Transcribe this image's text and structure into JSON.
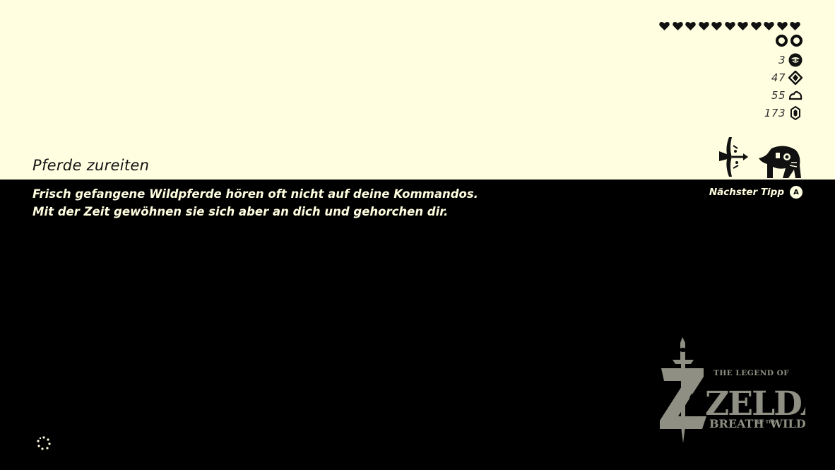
{
  "hint": {
    "title": "Pferde zureiten",
    "lines": [
      "Frisch gefangene Wildpferde hören oft nicht auf deine Kommandos.",
      "Mit der Zeit gewöhnen sie sich aber an dich und gehorchen dir."
    ],
    "next_label": "Nächster Tipp",
    "next_button": "A"
  },
  "hud": {
    "hearts": 11,
    "stamina_wheels": 2,
    "resources": [
      {
        "value": "3",
        "icon": "korok-seed-icon"
      },
      {
        "value": "47",
        "icon": "shrine-orb-icon"
      },
      {
        "value": "55",
        "icon": "monster-part-icon"
      },
      {
        "value": "173",
        "icon": "rupee-icon"
      }
    ]
  },
  "logo": {
    "line1": "THE LEGEND OF",
    "line2": "ZELDA",
    "line3a": "BREATH",
    "line3b": "OF THE",
    "line3c": "WILD"
  },
  "colors": {
    "top_bg": "#fffee0",
    "bottom_bg": "#000000",
    "text_light": "#fffee0",
    "text_dark": "#111111",
    "logo_gray": "#8f8f83"
  }
}
